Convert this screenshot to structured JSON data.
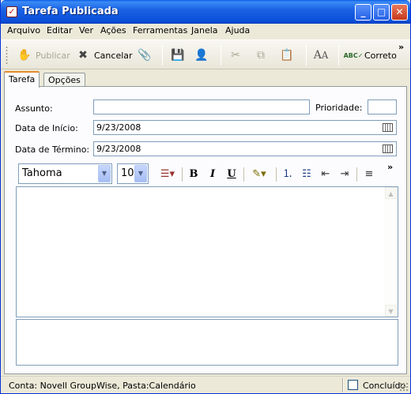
{
  "window": {
    "title": "Tarefa Publicada"
  },
  "menu": {
    "items": [
      {
        "label": "Arquivo"
      },
      {
        "label": "Editar"
      },
      {
        "label": "Ver"
      },
      {
        "label": "Ações"
      },
      {
        "label": "Ferramentas"
      },
      {
        "label": "Janela"
      },
      {
        "label": "Ajuda"
      }
    ]
  },
  "toolbar": {
    "publish_label": "Publicar",
    "cancel_label": "Cancelar",
    "spell_label": "Correto"
  },
  "tabs": [
    {
      "label": "Tarefa",
      "active": true
    },
    {
      "label": "Opções",
      "active": false
    }
  ],
  "form": {
    "subject_label": "Assunto:",
    "subject_value": "",
    "priority_label": "Prioridade:",
    "priority_value": "",
    "start_label": "Data de Início:",
    "start_value": "9/23/2008",
    "end_label": "Data de Término:",
    "end_value": "9/23/2008"
  },
  "format": {
    "font": "Tahoma",
    "size": "10"
  },
  "status": {
    "text": "Conta: Novell GroupWise,  Pasta:Calendário",
    "completed_label": "Concluído",
    "completed_checked": false
  },
  "colors": {
    "titlebar": "#0b50d8",
    "tab_accent": "#e68b2c",
    "input_border": "#7f9db9"
  }
}
